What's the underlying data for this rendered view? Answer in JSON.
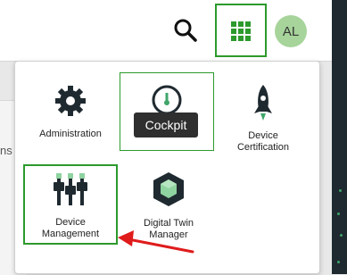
{
  "header": {
    "search_icon": "search-icon",
    "apps_icon": "grid-icon",
    "avatar_initials": "AL",
    "accent": "#2c9a2c",
    "avatar_color": "#a6d49a"
  },
  "background": {
    "partial_text": "ns"
  },
  "app_switcher": {
    "tiles": [
      {
        "label": "Administration",
        "icon": "gear-icon"
      },
      {
        "label": "",
        "icon": "gauge-icon"
      },
      {
        "label": "Device Certification",
        "icon": "rocket-icon"
      },
      {
        "label": "Device Management",
        "icon": "sliders-icon"
      },
      {
        "label": "Digital Twin Manager",
        "icon": "cube-icon"
      }
    ],
    "tooltip": "Cockpit"
  }
}
